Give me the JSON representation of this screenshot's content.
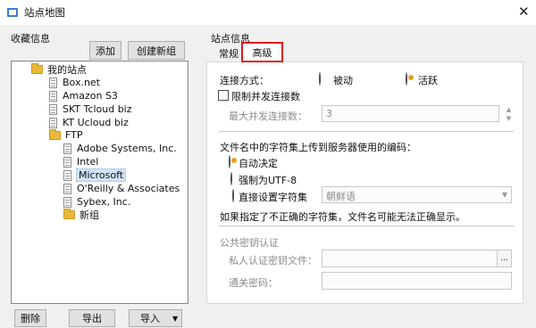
{
  "window": {
    "title": "站点地图",
    "close_glyph": "✕"
  },
  "favorites": {
    "label": "收藏信息",
    "add_label": "添加",
    "new_folder_label": "创建新组",
    "tree": {
      "root": "我的站点",
      "sites": [
        "Box.net",
        "Amazon S3",
        "SKT Tcloud biz",
        "KT Ucloud biz"
      ],
      "ftp": "FTP",
      "ftp_sites": [
        "Adobe Systems, Inc.",
        "Intel",
        "Microsoft",
        "O'Reilly & Associates",
        "Sybex, Inc."
      ],
      "new_group": "新组",
      "selected": "Microsoft"
    },
    "delete_label": "删除",
    "export_label": "导出",
    "import_label": "导入",
    "import_arrow": "▼"
  },
  "site_info": {
    "label": "站点信息",
    "tabs": [
      "常规",
      "高级"
    ],
    "active_tab": "高级",
    "connection_mode_label": "连接方式：",
    "passive_label": "被动",
    "active_label": "活跃",
    "limit_connections_label": "限制并发连接数",
    "max_connections_label": "最大并发连接数：",
    "max_connections_value": "3",
    "encoding_label": "文件名中的字符集上传到服务器使用的编码：",
    "auto_label": "自动决定",
    "force_utf8_label": "强制为UTF-8",
    "charset_label": "直接设置字符集",
    "charset_value": "朝鲜语",
    "warning": "如果指定了不正确的字符集，文件名可能无法正确显示。",
    "pubkey_label": "公共密钥认证",
    "private_key_label": "私人认证密钥文件：",
    "browse_label": "...",
    "passphrase_label": "通关密码："
  },
  "colors": {
    "highlight": "#e01b1b",
    "radio_accent": "#e8a21a",
    "folder": "#e8b93a"
  }
}
